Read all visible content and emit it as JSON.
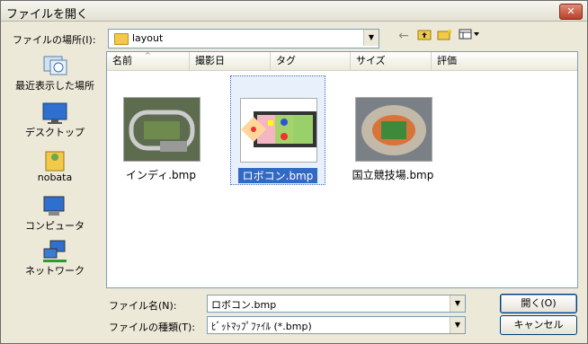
{
  "window": {
    "title": "ファイルを開く",
    "close_label": "✕"
  },
  "lookin": {
    "label": "ファイルの場所(I):",
    "value": "layout"
  },
  "toolbar": {
    "back_icon": "back-arrow-icon",
    "up_icon": "folder-up-icon",
    "new_icon": "new-folder-icon",
    "view_icon": "view-menu-icon"
  },
  "places": [
    {
      "label": "最近表示した場所",
      "icon": "recent-places-icon"
    },
    {
      "label": "デスクトップ",
      "icon": "desktop-icon"
    },
    {
      "label": "nobata",
      "icon": "user-folder-icon"
    },
    {
      "label": "コンピュータ",
      "icon": "computer-icon"
    },
    {
      "label": "ネットワーク",
      "icon": "network-icon"
    }
  ],
  "columns": [
    "名前",
    "撮影日",
    "タグ",
    "サイズ",
    "評価"
  ],
  "files": [
    {
      "name": "インディ.bmp",
      "selected": false
    },
    {
      "name": "ロボコン.bmp",
      "selected": true
    },
    {
      "name": "国立競技場.bmp",
      "selected": false
    }
  ],
  "filename": {
    "label": "ファイル名(N):",
    "value": "ロボコン.bmp"
  },
  "filetype": {
    "label": "ファイルの種類(T):",
    "value": "ﾋﾞｯﾄﾏｯﾌﾟﾌｧｲﾙ (*.bmp)"
  },
  "buttons": {
    "open": "開く(O)",
    "cancel": "キャンセル"
  }
}
